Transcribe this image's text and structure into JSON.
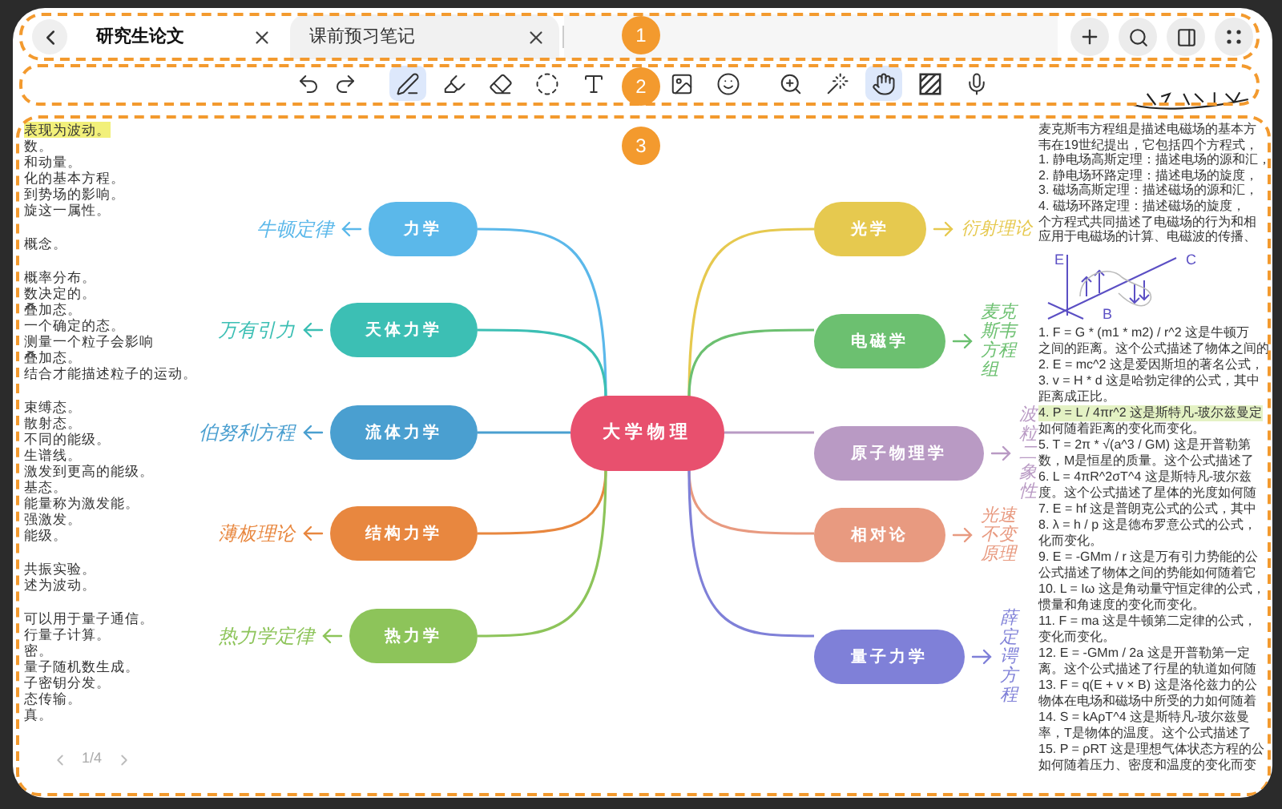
{
  "tabs": [
    {
      "label": "研究生论文",
      "selected": true
    },
    {
      "label": "课前预习笔记",
      "selected": false
    }
  ],
  "toolbar": {
    "groups": [
      [
        {
          "kind": "undo",
          "selected": false
        },
        {
          "kind": "redo",
          "selected": false
        }
      ],
      [
        {
          "kind": "pen",
          "selected": true
        },
        {
          "kind": "highlighter",
          "selected": false
        },
        {
          "kind": "eraser",
          "selected": false
        },
        {
          "kind": "lasso",
          "selected": false
        },
        {
          "kind": "text",
          "selected": false
        },
        {
          "kind": "image",
          "selected": false
        },
        {
          "kind": "sticker",
          "selected": false
        }
      ],
      [
        {
          "kind": "zoom",
          "selected": false
        },
        {
          "kind": "wand",
          "selected": false
        },
        {
          "kind": "hand",
          "selected": true
        },
        {
          "kind": "hatch",
          "selected": false
        },
        {
          "kind": "mic",
          "selected": false
        }
      ]
    ]
  },
  "left_notes": {
    "color": "#f2f07a",
    "paragraphs": [
      [
        {
          "text": "表现为波动。",
          "highlighted": true
        },
        {
          "text": "数。",
          "highlighted": false
        },
        {
          "text": "和动量。",
          "highlighted": false
        },
        {
          "text": "化的基本方程。",
          "highlighted": false
        },
        {
          "text": "到势场的影响。",
          "highlighted": false
        },
        {
          "text": "旋这一属性。",
          "highlighted": false
        }
      ],
      [
        {
          "text": "概念。",
          "highlighted": false
        }
      ],
      [
        {
          "text": "概率分布。",
          "highlighted": false
        },
        {
          "text": "数决定的。",
          "highlighted": false
        },
        {
          "text": "叠加态。",
          "highlighted": false
        },
        {
          "text": "一个确定的态。",
          "highlighted": false
        },
        {
          "text": "测量一个粒子会影响",
          "highlighted": false
        },
        {
          "text": "叠加态。",
          "highlighted": false
        },
        {
          "text": "结合才能描述粒子的运动。",
          "highlighted": false
        }
      ],
      [
        {
          "text": "束缚态。",
          "highlighted": false
        },
        {
          "text": "散射态。",
          "highlighted": false
        },
        {
          "text": "不同的能级。",
          "highlighted": false
        },
        {
          "text": "生谱线。",
          "highlighted": false
        },
        {
          "text": "激发到更高的能级。",
          "highlighted": false
        },
        {
          "text": "基态。",
          "highlighted": false
        },
        {
          "text": "能量称为激发能。",
          "highlighted": false
        },
        {
          "text": "强激发。",
          "highlighted": false
        },
        {
          "text": "能级。",
          "highlighted": false
        }
      ],
      [
        {
          "text": "共振实验。",
          "highlighted": false
        },
        {
          "text": "述为波动。",
          "highlighted": false
        }
      ],
      [
        {
          "text": "可以用于量子通信。",
          "highlighted": false
        },
        {
          "text": "行量子计算。",
          "highlighted": false
        },
        {
          "text": "密。",
          "highlighted": false
        },
        {
          "text": "量子随机数生成。",
          "highlighted": false
        },
        {
          "text": "子密钥分发。",
          "highlighted": false
        },
        {
          "text": "态传输。",
          "highlighted": false
        },
        {
          "text": "真。",
          "highlighted": false
        }
      ]
    ]
  },
  "page_indicator": "1/4",
  "mind_map": {
    "center": {
      "label": "大学物理",
      "color": "#e8506e"
    },
    "left_branches": [
      {
        "label": "力学",
        "color": "#5bb8ea",
        "annotation": "牛顿定律"
      },
      {
        "label": "天体力学",
        "color": "#3cbfb4",
        "annotation": "万有引力"
      },
      {
        "label": "流体力学",
        "color": "#4a9fd0",
        "annotation": "伯努利方程"
      },
      {
        "label": "结构力学",
        "color": "#e8873f",
        "annotation": "薄板理论"
      },
      {
        "label": "热力学",
        "color": "#8dc45a",
        "annotation": "热力学定律"
      }
    ],
    "right_branches": [
      {
        "label": "光学",
        "color": "#e6c94f",
        "annotation": "衍射理论"
      },
      {
        "label": "电磁学",
        "color": "#6cc070",
        "annotation": "麦克斯韦方程组"
      },
      {
        "label": "原子物理学",
        "color": "#b99ac4",
        "annotation": "波粒二象性"
      },
      {
        "label": "相对论",
        "color": "#e89a80",
        "annotation": "光速不变原理"
      },
      {
        "label": "量子力学",
        "color": "#7f80d8",
        "annotation": "薛定谔方程"
      }
    ]
  },
  "right_notes": {
    "color": "#e4f2c4",
    "intro": [
      "麦克斯韦方程组是描述电磁场的基本方",
      "韦在19世纪提出，它包括四个方程式，",
      "1. 静电场高斯定理：描述电场的源和汇，",
      "2. 静电场环路定理：描述电场的旋度，",
      "3. 磁场高斯定理：描述磁场的源和汇，",
      "4. 磁场环路定理：描述磁场的旋度，",
      "个方程式共同描述了电磁场的行为和相",
      "应用于电磁场的计算、电磁波的传播、"
    ],
    "sketch_labels": [
      "E",
      "C",
      "B"
    ],
    "formulas": [
      {
        "text": "1. F = G * (m1 * m2) / r^2 这是牛顿万",
        "highlighted": false
      },
      {
        "text": "之间的距离。这个公式描述了物体之间的",
        "highlighted": false
      },
      {
        "text": "2. E = mc^2 这是爱因斯坦的著名公式，",
        "highlighted": false
      },
      {
        "text": "3. v = H * d 这是哈勃定律的公式，其中",
        "highlighted": false
      },
      {
        "text": "距离成正比。",
        "highlighted": false
      },
      {
        "text": "4. P = L / 4πr^2 这是斯特凡-玻尔兹曼定",
        "highlighted": true
      },
      {
        "text": "如何随着距离的变化而变化。",
        "highlighted": false
      },
      {
        "text": "5. T = 2π * √(a^3 / GM) 这是开普勒第",
        "highlighted": false
      },
      {
        "text": "数，M是恒星的质量。这个公式描述了",
        "highlighted": false
      },
      {
        "text": "6. L = 4πR^2σT^4 这是斯特凡-玻尔兹",
        "highlighted": false
      },
      {
        "text": "度。这个公式描述了星体的光度如何随",
        "highlighted": false
      },
      {
        "text": "7. E = hf 这是普朗克公式的公式，其中",
        "highlighted": false
      },
      {
        "text": "8. λ = h / p 这是德布罗意公式的公式，",
        "highlighted": false
      },
      {
        "text": "化而变化。",
        "highlighted": false
      },
      {
        "text": "9. E = -GMm / r 这是万有引力势能的公",
        "highlighted": false
      },
      {
        "text": "公式描述了物体之间的势能如何随着它",
        "highlighted": false
      },
      {
        "text": "10. L = Iω 这是角动量守恒定律的公式，",
        "highlighted": false
      },
      {
        "text": "惯量和角速度的变化而变化。",
        "highlighted": false
      },
      {
        "text": "11. F = ma 这是牛顿第二定律的公式，",
        "highlighted": false
      },
      {
        "text": "变化而变化。",
        "highlighted": false
      },
      {
        "text": "12. E = -GMm / 2a 这是开普勒第一定",
        "highlighted": false
      },
      {
        "text": "离。这个公式描述了行星的轨道如何随",
        "highlighted": false
      },
      {
        "text": "13. F = q(E + v × B) 这是洛伦兹力的公",
        "highlighted": false
      },
      {
        "text": "物体在电场和磁场中所受的力如何随着",
        "highlighted": false
      },
      {
        "text": "14. S = kAρT^4 这是斯特凡-玻尔兹曼",
        "highlighted": false
      },
      {
        "text": "率，T是物体的温度。这个公式描述了",
        "highlighted": false
      },
      {
        "text": "15. P = ρRT 这是理想气体状态方程的公",
        "highlighted": false
      },
      {
        "text": "如何随着压力、密度和温度的变化而变",
        "highlighted": false
      }
    ]
  },
  "callouts": [
    "1",
    "2",
    "3"
  ]
}
